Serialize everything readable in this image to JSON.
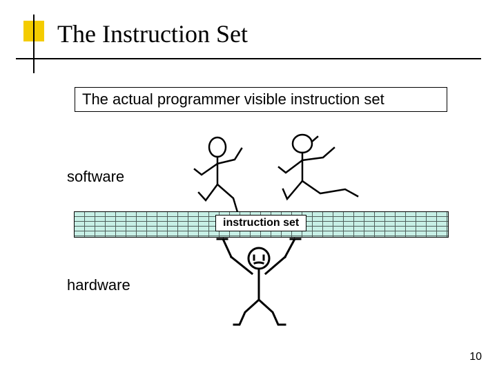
{
  "slide": {
    "title": "The Instruction Set",
    "description": "The actual programmer visible instruction set",
    "label_software": "software",
    "label_hardware": "hardware",
    "instruction_label": "instruction set",
    "page_number": "10"
  }
}
